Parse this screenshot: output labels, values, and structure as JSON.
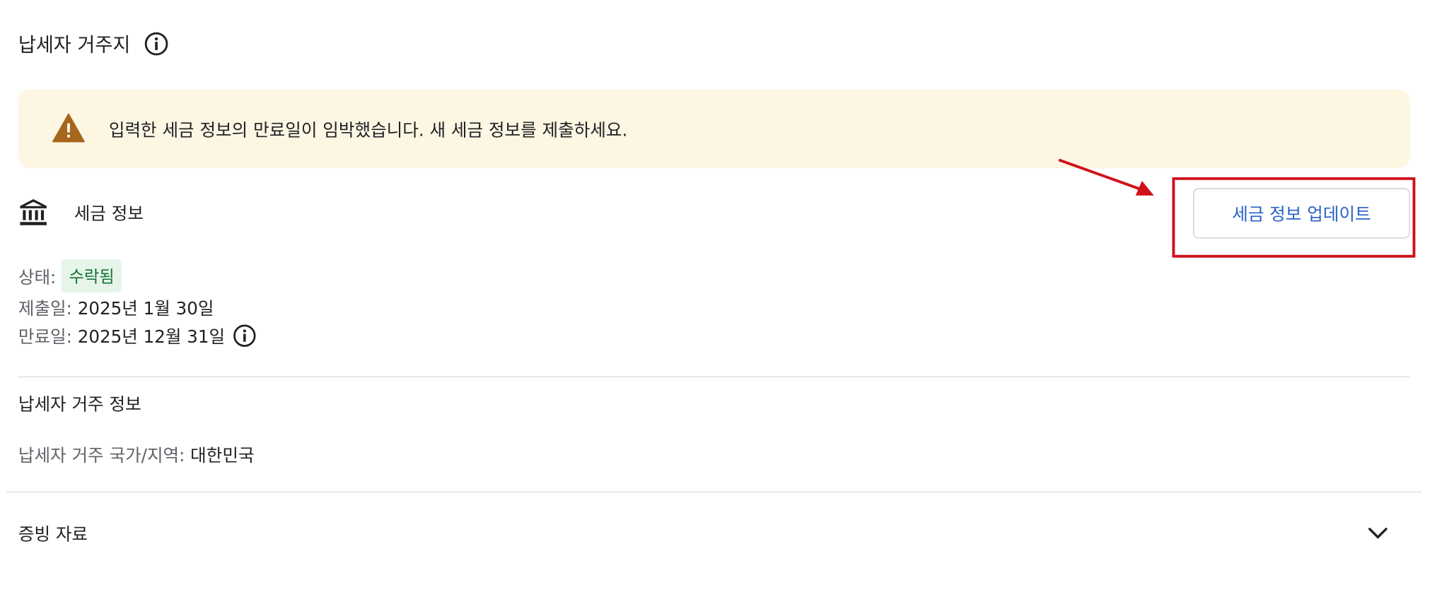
{
  "page": {
    "title": "납세자 거주지"
  },
  "alert": {
    "message": "입력한 세금 정보의 만료일이 임박했습니다. 새 세금 정보를 제출하세요.",
    "icon": "warning-icon",
    "icon_color": "#a6661d",
    "background": "#fdf6e3"
  },
  "tax_info": {
    "title": "세금 정보",
    "update_button": "세금 정보 업데이트",
    "status_label": "상태:",
    "status_value": "수락됨",
    "submitted_label": "제출일:",
    "submitted_value": "2025년 1월 30일",
    "expiry_label": "만료일:",
    "expiry_value": "2025년 12월 31일"
  },
  "residency": {
    "title": "납세자 거주 정보",
    "country_label": "납세자 거주 국가/지역:",
    "country_value": "대한민국"
  },
  "documents": {
    "title": "증빙 자료"
  },
  "colors": {
    "link": "#2762c4",
    "status_bg": "#e6f4ea",
    "status_text": "#137333",
    "highlight": "#d0101a"
  }
}
